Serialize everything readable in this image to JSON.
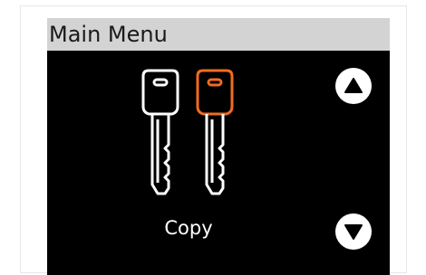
{
  "screen": {
    "title": "Main Menu",
    "current_item": "Copy",
    "icon": "two-keys-icon",
    "colors": {
      "background": "#000000",
      "title_bar": "#d3d3d3",
      "key_primary": "#ffffff",
      "key_accent": "#f26b21"
    }
  },
  "navigation": {
    "up_icon": "triangle-up-icon",
    "down_icon": "triangle-down-icon"
  }
}
